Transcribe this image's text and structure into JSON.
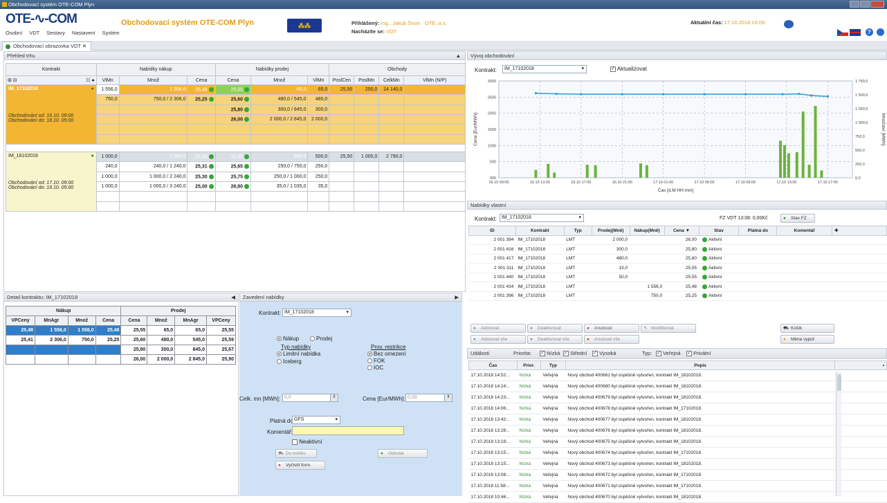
{
  "window": {
    "title": "Obchodovací systém OTE-COM Plyn"
  },
  "header": {
    "logo": "OTE-∿-COM",
    "system_title": "Obchodovací systém OTE-COM Plyn",
    "emblem": "",
    "menu": [
      "Osobní",
      "VDT",
      "Sestavy",
      "Nastavení",
      "Systém"
    ],
    "user_label": "Přihlášený:",
    "user_value": "Ing., Jakub Šrom · OTE, a.s.",
    "location_label": "Nacházíte se:",
    "location_value": "VDT",
    "clock_label": "Aktuální čas:",
    "clock_value": "17.10.2018 16:09:"
  },
  "tab": {
    "label": "Obchodovací obrazovka VDT ✕"
  },
  "prehled": {
    "title": "Přehled trhu",
    "groups": [
      "Kontrakt",
      "Nabídky nákup",
      "Nabídky prodej",
      "Obchody"
    ],
    "columns": [
      "VlMn",
      "Množ",
      "Cena",
      "Cena",
      "Množ",
      "VlMn",
      "PoslCen",
      "PoslMn",
      "CelkMn",
      "VlMn (N/P)"
    ],
    "k1": {
      "name": "IM_17102018",
      "od": "Obchodování od: 16.10. 09:00",
      "do": "Obchodování do: 18.10. 05:00",
      "rows": [
        [
          "1 556,0",
          "1 556,0",
          "25,48",
          "25,55",
          "65,0",
          "65,0",
          "25,50",
          "250,0",
          "14 140,0",
          ""
        ],
        [
          "750,0",
          "750,0 / 2 306,0",
          "25,25",
          "25,60",
          "480,0 / 545,0",
          "480,0",
          "",
          "",
          "",
          ""
        ],
        [
          "",
          "",
          "",
          "25,80",
          "300,0 / 845,0",
          "300,0",
          "",
          "",
          "",
          ""
        ],
        [
          "",
          "",
          "",
          "26,00",
          "2 000,0 / 2 845,0",
          "2 000,0",
          "",
          "",
          "",
          ""
        ]
      ]
    },
    "k2": {
      "name": "IM_18102018",
      "od": "Obchodování od: 17.10. 09:00",
      "do": "Obchodování do: 19.10. 05:00",
      "rows": [
        [
          "1 000,0",
          "1 000,0",
          "25,40",
          "25,55",
          "500,0",
          "500,0",
          "25,50",
          "1 000,0",
          "2 790,0",
          ""
        ],
        [
          "240,0",
          "240,0 / 1 240,0",
          "25,31",
          "25,65",
          "250,0 / 750,0",
          "250,0",
          "",
          "",
          "",
          ""
        ],
        [
          "1 000,0",
          "1 000,0 / 2 240,0",
          "25,30",
          "25,75",
          "250,0 / 1 000,0",
          "250,0",
          "",
          "",
          "",
          ""
        ],
        [
          "1 000,0",
          "1 000,0 / 3 240,0",
          "25,00",
          "26,80",
          "35,0 / 1 035,0",
          "35,0",
          "",
          "",
          "",
          ""
        ]
      ]
    }
  },
  "detail": {
    "title": "Detail kontraktu: IM_17102018",
    "nakup": "Nákup",
    "prodej": "Prodej",
    "cols": [
      "VPCeny",
      "MnAgr",
      "Množ",
      "Cena",
      "Cena",
      "Množ",
      "MnAgr",
      "VPCeny"
    ],
    "rows": [
      [
        "25,48",
        "1 556,0",
        "1 556,0",
        "25,48",
        "25,55",
        "65,0",
        "65,0",
        "25,55"
      ],
      [
        "25,41",
        "2 306,0",
        "750,0",
        "25,25",
        "25,60",
        "480,0",
        "545,0",
        "25,59"
      ],
      [
        "",
        "",
        "",
        "",
        "25,80",
        "300,0",
        "845,0",
        "25,67"
      ],
      [
        "",
        "",
        "",
        "",
        "26,00",
        "2 000,0",
        "2 845,0",
        "25,90"
      ]
    ]
  },
  "zavedeni": {
    "title": "Zavedení nabídky",
    "kontrakt_label": "Kontrakt:",
    "kontrakt_value": "IM_17102018",
    "nakup": "Nákup",
    "prodej": "Prodej",
    "typ_label": "Typ nabídky",
    "limitni": "Limitní nabídka",
    "iceberg": "Iceberg",
    "prov_label": "Prov. restrikce",
    "bez": "Bez omezení",
    "fok": "FOK",
    "ioc": "IOC",
    "celk_label": "Celk. mn [MWh]:",
    "celk_value": "0,0",
    "cena_label": "Cena [Eur/MWh]:",
    "cena_value": "0,00",
    "platna_label": "Platná do:",
    "platna_value": "GFS",
    "koment_label": "Komentář:",
    "neaktivni": "Neaktivní",
    "do_kosiku": "Do košíku",
    "odeslat": "Odeslat",
    "vycistit": "Vyčistit form."
  },
  "vyvoj": {
    "title": "Vývoj obchodování",
    "kontrakt_label": "Kontrakt:",
    "kontrakt_value": "IM_17102018",
    "aktualizovat": "Aktualizovat"
  },
  "chart_data": {
    "type": "bar+line",
    "title": "",
    "xlabel": "Čas [d.M HH:mm]",
    "ylabel": "Cena [Eur/MWh]",
    "y2label": "Množství [MWh]",
    "yticks": [
      "000",
      "500",
      "1000",
      "1500",
      "2000",
      "2500",
      "3000"
    ],
    "y2ticks": [
      "0,0",
      "250,0",
      "500,0",
      "750,0",
      "1 000,0",
      "1 250,0",
      "1 500,0",
      "1 750,0"
    ],
    "xticks": [
      "16.10 09:00",
      "16.10 13:00",
      "16.10 17:00",
      "16.10 21:00",
      "17.10 01:00",
      "17.10 05:00",
      "17.10 09:00",
      "17.10 13:00",
      "17.10 17:00"
    ],
    "bars": [
      [
        0.9,
        180
      ],
      [
        1.2,
        320
      ],
      [
        1.35,
        120
      ],
      [
        2.15,
        300
      ],
      [
        2.35,
        290
      ],
      [
        3.45,
        330
      ],
      [
        3.6,
        290
      ],
      [
        6.85,
        850
      ],
      [
        6.95,
        750
      ],
      [
        7.05,
        560
      ],
      [
        7.25,
        590
      ],
      [
        7.4,
        1520
      ],
      [
        7.55,
        300
      ],
      [
        7.7,
        1650
      ],
      [
        7.85,
        170
      ]
    ],
    "line": [
      [
        0.9,
        2620
      ],
      [
        1.4,
        2600
      ],
      [
        2,
        2590
      ],
      [
        3,
        2590
      ],
      [
        4,
        2590
      ],
      [
        5,
        2590
      ],
      [
        6,
        2590
      ],
      [
        6.9,
        2590
      ],
      [
        7.3,
        2600
      ],
      [
        7.6,
        2550
      ],
      [
        8,
        2520
      ]
    ]
  },
  "nabidky": {
    "title": "Nabídky vlastní",
    "kontrakt_label": "Kontrakt:",
    "kontrakt_value": "IM_17102018",
    "fz": "FZ VDT 13:38: 0,00Kč",
    "stav_btn": "Stav FZ",
    "cols": [
      "ID",
      "Kontrakt",
      "Typ",
      "Prodej(Mně)",
      "Nákup(Mně)",
      "Cena ▼",
      "Stav",
      "Platná do",
      "Komentář"
    ],
    "rows": [
      [
        "2 001 394",
        "IM_17102018",
        "LMT",
        "2 000,0",
        "",
        "26,00",
        "Aktivní"
      ],
      [
        "2 001 416",
        "IM_17102018",
        "LMT",
        "300,0",
        "",
        "25,80",
        "Aktivní"
      ],
      [
        "2 001 417",
        "IM_17102018",
        "LMT",
        "480,0",
        "",
        "25,60",
        "Aktivní"
      ],
      [
        "2 001 311",
        "IM_17102018",
        "LMT",
        "15,0",
        "",
        "25,55",
        "Aktivní"
      ],
      [
        "2 001 440",
        "IM_17102018",
        "LMT",
        "50,0",
        "",
        "25,55",
        "Aktivní"
      ],
      [
        "2 001 434",
        "IM_17102018",
        "LMT",
        "",
        "1 556,0",
        "25,48",
        "Aktivní"
      ],
      [
        "2 001 396",
        "IM_17102018",
        "LMT",
        "",
        "750,0",
        "25,25",
        "Aktivní"
      ]
    ],
    "btns": [
      "Aktivovat",
      "Deaktivovat",
      "Anulovat",
      "Modifikovat",
      "Aktivovat vše",
      "Deaktivovat vše",
      "Anulovat vše",
      "Košík",
      "Měna vypoř."
    ]
  },
  "udalosti": {
    "title": "Události",
    "priorita": "Priorita:",
    "nizka": "Nízká",
    "stredni": "Střední",
    "vysoka": "Vysoká",
    "typ": "Typ:",
    "verejna": "Veřejná",
    "privatni": "Privátní",
    "cols": [
      "Čas",
      "Prior.",
      "Typ",
      "Popis"
    ],
    "rows": [
      [
        "17.10.2018 14:52:..",
        "Nízká",
        "Veřejná",
        "Nový obchod 400681 byl úspěšně vytvořen, kontrakt IM_18102018."
      ],
      [
        "17.10.2018 14:24:..",
        "Nízká",
        "Veřejná",
        "Nový obchod 400680 byl úspěšně vytvořen, kontrakt IM_18102018."
      ],
      [
        "17.10.2018 14:23:..",
        "Nízká",
        "Veřejná",
        "Nový obchod 400679 byl úspěšně vytvořen, kontrakt IM_18102018."
      ],
      [
        "17.10.2018 14:06:..",
        "Nízká",
        "Veřejná",
        "Nový obchod 400678 byl úspěšně vytvořen, kontrakt IM_17102018."
      ],
      [
        "17.10.2018 13:42:..",
        "Nízká",
        "Veřejná",
        "Nový obchod 400677 byl úspěšně vytvořen, kontrakt IM_18102018."
      ],
      [
        "17.10.2018 13:28:..",
        "Nízká",
        "Veřejná",
        "Nový obchod 400676 byl úspěšně vytvořen, kontrakt IM_18102018."
      ],
      [
        "17.10.2018 13:18:..",
        "Nízká",
        "Veřejná",
        "Nový obchod 400675 byl úspěšně vytvořen, kontrakt IM_18102018."
      ],
      [
        "17.10.2018 13:15:..",
        "Nízká",
        "Veřejná",
        "Nový obchod 400674 byl úspěšně vytvořen, kontrakt IM_17102018."
      ],
      [
        "17.10.2018 13:15:..",
        "Nízká",
        "Veřejná",
        "Nový obchod 400673 byl úspěšně vytvořen, kontrakt IM_18102018."
      ],
      [
        "17.10.2018 13:08:..",
        "Nízká",
        "Veřejná",
        "Nový obchod 400672 byl úspěšně vytvořen, kontrakt IM_17102018."
      ],
      [
        "17.10.2018 11:58:..",
        "Nízká",
        "Veřejná",
        "Nový obchod 400671 byl úspěšně vytvořen, kontrakt IM_17102018."
      ],
      [
        "17.10.2018 10:46:..",
        "Nízká",
        "Veřejná",
        "Nový obchod 400670 byl úspěšně vytvořen, kontrakt IM_18102018."
      ]
    ]
  }
}
